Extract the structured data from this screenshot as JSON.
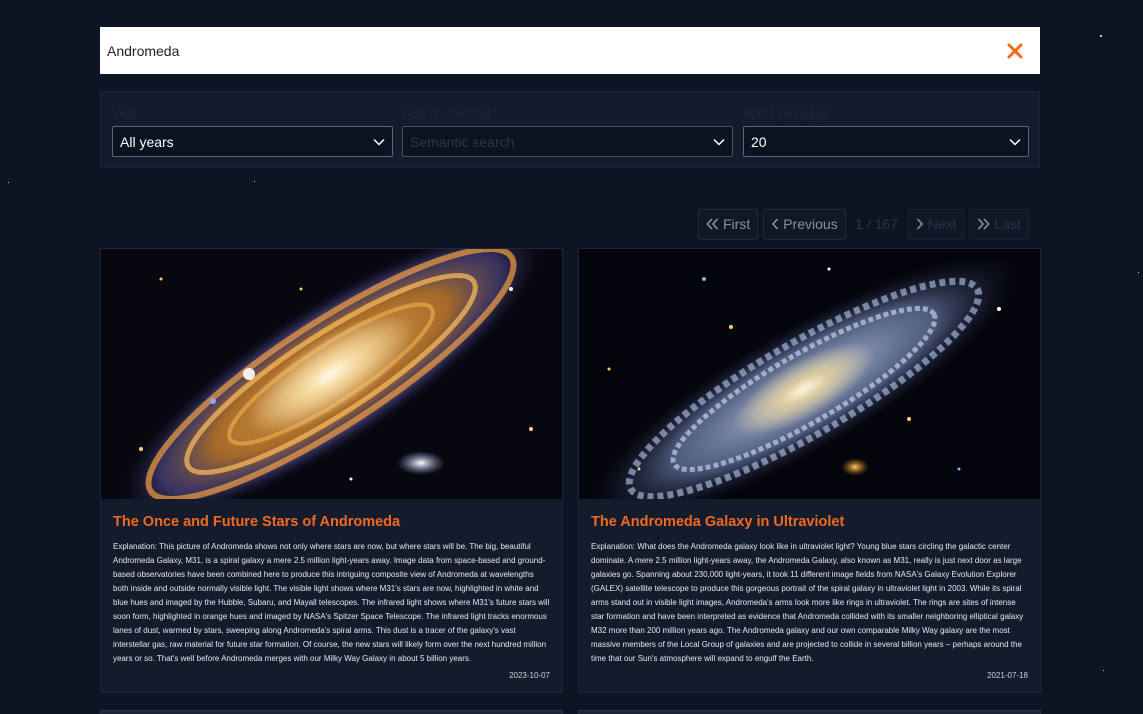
{
  "search": {
    "value": "Andromeda"
  },
  "filters": {
    "year": {
      "label": "Year",
      "value": "All years"
    },
    "method": {
      "label": "Search method",
      "value": "Semantic search"
    },
    "per_page": {
      "label": "Items per page",
      "value": "20"
    }
  },
  "pagination": {
    "first": "First",
    "previous": "Previous",
    "indicator": "1 / 167",
    "next": "Next",
    "last": "Last"
  },
  "cards": [
    {
      "title": "The Once and Future Stars of Andromeda",
      "explanation": "Explanation: This picture of Andromeda shows not only where stars are now, but where stars will be. The big, beautiful Andromeda Galaxy, M31, is a spiral galaxy a mere 2.5 million light-years away. Image data from space-based and ground-based observatories have been combined here to produce this intriguing composite view of Andromeda at wavelengths both inside and outside normally visible light. The visible light shows where M31's stars are now, highlighted in white and blue hues and imaged by the Hubble, Subaru, and Mayall telescopes. The infrared light shows where M31's future stars will soon form, highlighted in orange hues and imaged by NASA's Spitzer Space Telescope. The infrared light tracks enormous lanes of dust, warmed by stars, sweeping along Andromeda's spiral arms. This dust is a tracer of the galaxy's vast interstellar gas, raw material for future star formation. Of course, the new stars will likely form over the next hundred million years or so. That's well before Andromeda merges with our Milky Way Galaxy in about 5 billion years.",
      "date": "2023-10-07"
    },
    {
      "title": "The Andromeda Galaxy in Ultraviolet",
      "explanation": "Explanation: What does the Andromeda galaxy look like in ultraviolet light? Young blue stars circling the galactic center dominate. A mere 2.5 million light-years away, the Andromeda Galaxy, also known as M31, really is just next door as large galaxies go. Spanning about 230,000 light-years, it took 11 different image fields from NASA's Galaxy Evolution Explorer (GALEX) satellite telescope to produce this gorgeous portrait of the spiral galaxy in ultraviolet light in 2003. While its spiral arms stand out in visible light images, Andromeda's arms look more like rings in ultraviolet. The rings are sites of intense star formation and have been interpreted as evidence that Andromeda collided with its smaller neighboring elliptical galaxy M32 more than 200 million years ago. The Andromeda galaxy and our own comparable Milky Way galaxy are the most massive members of the Local Group of galaxies and are projected to collide in several billion years – perhaps around the time that our Sun's atmosphere will expand to engulf the Earth.",
      "date": "2021-07-18"
    }
  ],
  "colors": {
    "accent": "#f26a1d",
    "background": "#0d1424",
    "panel": "#131b2d"
  },
  "icons": [
    "close-icon",
    "chevron-down-icon",
    "double-chevron-left-icon",
    "chevron-left-icon",
    "chevron-right-icon",
    "double-chevron-right-icon"
  ]
}
